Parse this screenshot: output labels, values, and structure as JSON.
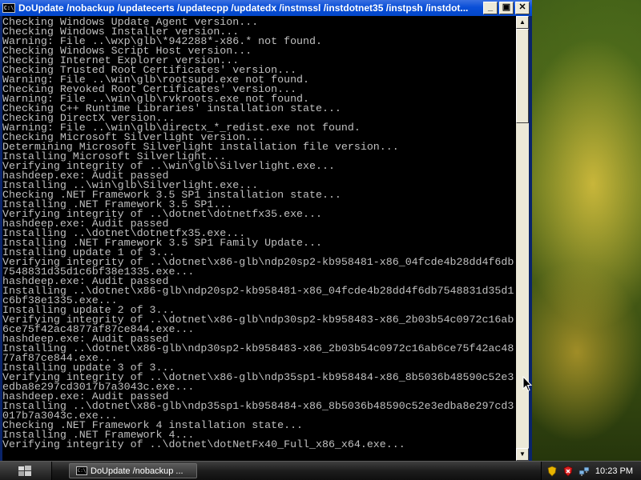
{
  "window": {
    "title": "DoUpdate /nobackup /updatecerts /updatecpp /updatedx /instmssl /instdotnet35 /instpsh /instdot...",
    "icon": "console-icon",
    "buttons": {
      "minimize": "_",
      "maximize": "▣",
      "close": "✕"
    }
  },
  "console": {
    "lines": [
      "Checking Windows Update Agent version...",
      "Checking Windows Installer version...",
      "Warning: File ..\\wxp\\glb\\*942288*-x86.* not found.",
      "Checking Windows Script Host version...",
      "Checking Internet Explorer version...",
      "Checking Trusted Root Certificates' version...",
      "Warning: File ..\\win\\glb\\rootsupd.exe not found.",
      "Checking Revoked Root Certificates' version...",
      "Warning: File ..\\win\\glb\\rvkroots.exe not found.",
      "Checking C++ Runtime Libraries' installation state...",
      "Checking DirectX version...",
      "Warning: File ..\\win\\glb\\directx_*_redist.exe not found.",
      "Checking Microsoft Silverlight version...",
      "Determining Microsoft Silverlight installation file version...",
      "Installing Microsoft Silverlight...",
      "Verifying integrity of ..\\win\\glb\\Silverlight.exe...",
      "hashdeep.exe: Audit passed",
      "Installing ..\\win\\glb\\Silverlight.exe...",
      "Checking .NET Framework 3.5 SP1 installation state...",
      "Installing .NET Framework 3.5 SP1...",
      "Verifying integrity of ..\\dotnet\\dotnetfx35.exe...",
      "hashdeep.exe: Audit passed",
      "Installing ..\\dotnet\\dotnetfx35.exe...",
      "Installing .NET Framework 3.5 SP1 Family Update...",
      "Installing update 1 of 3...",
      "Verifying integrity of ..\\dotnet\\x86-glb\\ndp20sp2-kb958481-x86_04fcde4b28dd4f6db",
      "7548831d35d1c6bf38e1335.exe...",
      "hashdeep.exe: Audit passed",
      "Installing ..\\dotnet\\x86-glb\\ndp20sp2-kb958481-x86_04fcde4b28dd4f6db7548831d35d1",
      "c6bf38e1335.exe...",
      "Installing update 2 of 3...",
      "Verifying integrity of ..\\dotnet\\x86-glb\\ndp30sp2-kb958483-x86_2b03b54c0972c16ab",
      "6ce75f42ac4877af87ce844.exe...",
      "hashdeep.exe: Audit passed",
      "Installing ..\\dotnet\\x86-glb\\ndp30sp2-kb958483-x86_2b03b54c0972c16ab6ce75f42ac48",
      "77af87ce844.exe...",
      "Installing update 3 of 3...",
      "Verifying integrity of ..\\dotnet\\x86-glb\\ndp35sp1-kb958484-x86_8b5036b48590c52e3",
      "edba8e297cd3017b7a3043c.exe...",
      "hashdeep.exe: Audit passed",
      "Installing ..\\dotnet\\x86-glb\\ndp35sp1-kb958484-x86_8b5036b48590c52e3edba8e297cd3",
      "017b7a3043c.exe...",
      "Checking .NET Framework 4 installation state...",
      "Installing .NET Framework 4...",
      "Verifying integrity of ..\\dotnet\\dotNetFx40_Full_x86_x64.exe..."
    ]
  },
  "taskbar": {
    "start_icon": "windows-logo-icon",
    "task_label": "DoUpdate /nobackup ...",
    "tray_icons": [
      "security-shield-icon",
      "security-alert-icon",
      "network-icon"
    ],
    "clock": "10:23 PM"
  },
  "colors": {
    "console_bg": "#000000",
    "console_fg": "#c0c0c0",
    "titlebar": "#0a4fd8"
  }
}
